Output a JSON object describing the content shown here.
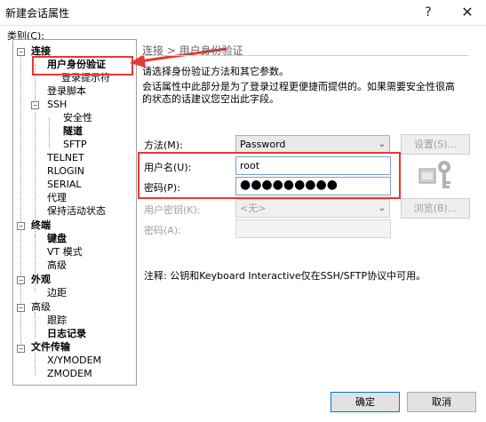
{
  "window": {
    "title": "新建会话属性",
    "help_glyph": "?",
    "close_glyph": "✕"
  },
  "category_label": "类别(C):",
  "tree": {
    "connection": "连接",
    "user_auth": "用户身份验证",
    "login_prompt": "登录提示符",
    "login_script": "登录脚本",
    "ssh": "SSH",
    "security": "安全性",
    "tunnel": "隧道",
    "sftp": "SFTP",
    "telnet": "TELNET",
    "rlogin": "RLOGIN",
    "serial": "SERIAL",
    "proxy": "代理",
    "keepalive": "保持活动状态",
    "terminal": "终端",
    "keyboard": "键盘",
    "vt_mode": "VT 模式",
    "advanced": "高级",
    "appearance": "外观",
    "margin": "边距",
    "advanced2": "高级",
    "trace": "跟踪",
    "logging": "日志记录",
    "file_transfer": "文件传输",
    "xymodem": "X/YMODEM",
    "zmodem": "ZMODEM"
  },
  "panel": {
    "section_title": "连接 > 用户身份验证",
    "intro": "请选择身份验证方法和其它参数。",
    "desc_line1": "会话属性中此部分是为了登录过程更便捷而提供的。如果需要安全性很高",
    "desc_line2": "的状态的话建议您空出此字段。",
    "method_label": "方法(M):",
    "method_value": "Password",
    "settings_button": "设置(S)...",
    "username_label": "用户名(U):",
    "username_value": "root",
    "password_label": "密码(P):",
    "password_value": "●●●●●●●●●",
    "userkey_label": "用户密钥(K):",
    "userkey_value": "<无>",
    "browse_button": "浏览(B)...",
    "passphrase_label": "密码(A):",
    "note": "注释: 公钥和Keyboard Interactive仅在SSH/SFTP协议中可用。"
  },
  "footer": {
    "ok": "确定",
    "cancel": "取消"
  },
  "colors": {
    "annotation": "#e53935",
    "accent": "#0078d7"
  }
}
